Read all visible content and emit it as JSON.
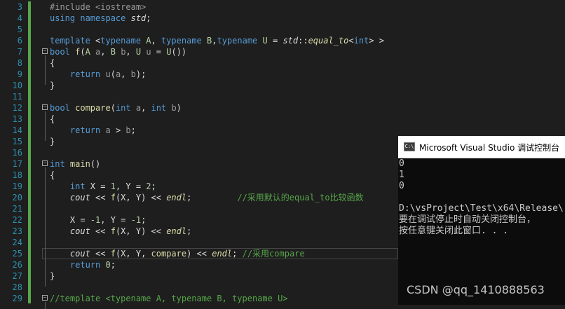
{
  "editor": {
    "lines": [
      {
        "num": "3",
        "tokens": [
          {
            "t": "#include <iostream>",
            "c": "pp"
          }
        ]
      },
      {
        "num": "4",
        "tokens": [
          {
            "t": "using namespace ",
            "c": "kw"
          },
          {
            "t": "std",
            "c": "ns"
          },
          {
            "t": ";",
            "c": "id"
          }
        ]
      },
      {
        "num": "5",
        "tokens": []
      },
      {
        "num": "6",
        "tokens": [
          {
            "t": "template ",
            "c": "kw"
          },
          {
            "t": "<",
            "c": "id"
          },
          {
            "t": "typename ",
            "c": "kw"
          },
          {
            "t": "A",
            "c": "tp"
          },
          {
            "t": ", ",
            "c": "id"
          },
          {
            "t": "typename ",
            "c": "kw"
          },
          {
            "t": "B",
            "c": "tp"
          },
          {
            "t": ",",
            "c": "id"
          },
          {
            "t": "typename ",
            "c": "kw"
          },
          {
            "t": "U",
            "c": "tp"
          },
          {
            "t": " = ",
            "c": "id"
          },
          {
            "t": "std",
            "c": "ns"
          },
          {
            "t": "::",
            "c": "id"
          },
          {
            "t": "equal_to",
            "c": "ital-fn"
          },
          {
            "t": "<",
            "c": "id"
          },
          {
            "t": "int",
            "c": "kw"
          },
          {
            "t": "> >",
            "c": "id"
          }
        ]
      },
      {
        "num": "7",
        "fold": true,
        "tokens": [
          {
            "t": "bool ",
            "c": "kw"
          },
          {
            "t": "f",
            "c": "fn"
          },
          {
            "t": "(",
            "c": "id"
          },
          {
            "t": "A ",
            "c": "tp"
          },
          {
            "t": "a",
            "c": "par"
          },
          {
            "t": ", ",
            "c": "id"
          },
          {
            "t": "B ",
            "c": "tp"
          },
          {
            "t": "b",
            "c": "par"
          },
          {
            "t": ", ",
            "c": "id"
          },
          {
            "t": "U ",
            "c": "tp"
          },
          {
            "t": "u",
            "c": "par"
          },
          {
            "t": " = ",
            "c": "id"
          },
          {
            "t": "U",
            "c": "tp"
          },
          {
            "t": "())",
            "c": "id"
          }
        ]
      },
      {
        "num": "8",
        "tokens": [
          {
            "t": "{",
            "c": "id"
          }
        ]
      },
      {
        "num": "9",
        "tokens": [
          {
            "t": "    return ",
            "c": "kw"
          },
          {
            "t": "u",
            "c": "par"
          },
          {
            "t": "(",
            "c": "id"
          },
          {
            "t": "a",
            "c": "par"
          },
          {
            "t": ", ",
            "c": "id"
          },
          {
            "t": "b",
            "c": "par"
          },
          {
            "t": ");",
            "c": "id"
          }
        ]
      },
      {
        "num": "10",
        "tokens": [
          {
            "t": "}",
            "c": "id"
          }
        ]
      },
      {
        "num": "11",
        "tokens": []
      },
      {
        "num": "12",
        "fold": true,
        "tokens": [
          {
            "t": "bool ",
            "c": "kw"
          },
          {
            "t": "compare",
            "c": "fn"
          },
          {
            "t": "(",
            "c": "id"
          },
          {
            "t": "int ",
            "c": "kw"
          },
          {
            "t": "a",
            "c": "par"
          },
          {
            "t": ", ",
            "c": "id"
          },
          {
            "t": "int ",
            "c": "kw"
          },
          {
            "t": "b",
            "c": "par"
          },
          {
            "t": ")",
            "c": "id"
          }
        ]
      },
      {
        "num": "13",
        "tokens": [
          {
            "t": "{",
            "c": "id"
          }
        ]
      },
      {
        "num": "14",
        "tokens": [
          {
            "t": "    return ",
            "c": "kw"
          },
          {
            "t": "a",
            "c": "par"
          },
          {
            "t": " > ",
            "c": "id"
          },
          {
            "t": "b",
            "c": "par"
          },
          {
            "t": ";",
            "c": "id"
          }
        ]
      },
      {
        "num": "15",
        "tokens": [
          {
            "t": "}",
            "c": "id"
          }
        ]
      },
      {
        "num": "16",
        "tokens": []
      },
      {
        "num": "17",
        "fold": true,
        "tokens": [
          {
            "t": "int ",
            "c": "kw"
          },
          {
            "t": "main",
            "c": "fn"
          },
          {
            "t": "()",
            "c": "id"
          }
        ]
      },
      {
        "num": "18",
        "tokens": [
          {
            "t": "{",
            "c": "id"
          }
        ]
      },
      {
        "num": "19",
        "tokens": [
          {
            "t": "    int ",
            "c": "kw"
          },
          {
            "t": "X = ",
            "c": "id"
          },
          {
            "t": "1",
            "c": "num"
          },
          {
            "t": ", Y = ",
            "c": "id"
          },
          {
            "t": "2",
            "c": "num"
          },
          {
            "t": ";",
            "c": "id"
          }
        ]
      },
      {
        "num": "20",
        "tokens": [
          {
            "t": "    ",
            "c": "id"
          },
          {
            "t": "cout",
            "c": "ns"
          },
          {
            "t": " << ",
            "c": "id"
          },
          {
            "t": "f",
            "c": "fn"
          },
          {
            "t": "(X, Y) << ",
            "c": "id"
          },
          {
            "t": "endl",
            "c": "ital-fn"
          },
          {
            "t": ";         ",
            "c": "id"
          },
          {
            "t": "//采用默认的equal_to比较函数",
            "c": "cmt"
          }
        ]
      },
      {
        "num": "21",
        "tokens": []
      },
      {
        "num": "22",
        "tokens": [
          {
            "t": "    X = ",
            "c": "id"
          },
          {
            "t": "-1",
            "c": "num"
          },
          {
            "t": ", Y = ",
            "c": "id"
          },
          {
            "t": "-1",
            "c": "num"
          },
          {
            "t": ";",
            "c": "id"
          }
        ]
      },
      {
        "num": "23",
        "tokens": [
          {
            "t": "    ",
            "c": "id"
          },
          {
            "t": "cout",
            "c": "ns"
          },
          {
            "t": " << ",
            "c": "id"
          },
          {
            "t": "f",
            "c": "fn"
          },
          {
            "t": "(X, Y) << ",
            "c": "id"
          },
          {
            "t": "endl",
            "c": "ital-fn"
          },
          {
            "t": ";",
            "c": "id"
          }
        ]
      },
      {
        "num": "24",
        "tokens": []
      },
      {
        "num": "25",
        "current": true,
        "tokens": [
          {
            "t": "    ",
            "c": "id"
          },
          {
            "t": "cout",
            "c": "ns"
          },
          {
            "t": " << ",
            "c": "id"
          },
          {
            "t": "f",
            "c": "fn"
          },
          {
            "t": "(X, Y, ",
            "c": "id"
          },
          {
            "t": "compare",
            "c": "fn"
          },
          {
            "t": ") << ",
            "c": "id"
          },
          {
            "t": "endl",
            "c": "ital-fn"
          },
          {
            "t": "; ",
            "c": "id"
          },
          {
            "t": "//采用compare",
            "c": "cmt"
          }
        ]
      },
      {
        "num": "26",
        "tokens": [
          {
            "t": "    return ",
            "c": "kw"
          },
          {
            "t": "0",
            "c": "num"
          },
          {
            "t": ";",
            "c": "id"
          }
        ]
      },
      {
        "num": "27",
        "tokens": [
          {
            "t": "}",
            "c": "id"
          }
        ]
      },
      {
        "num": "28",
        "tokens": []
      },
      {
        "num": "29",
        "fold": true,
        "tokens": [
          {
            "t": "//template <typename A, typename B, typename U>",
            "c": "cmt"
          }
        ]
      }
    ]
  },
  "console": {
    "icon_label": "C:\\",
    "title": "Microsoft Visual Studio 调试控制台",
    "output": [
      "0",
      "1",
      "0",
      "",
      "D:\\vsProject\\Test\\x64\\Release\\",
      "要在调试停止时自动关闭控制台，",
      "按任意键关闭此窗口. . ."
    ]
  },
  "watermark": "CSDN @qq_1410888563",
  "colors": {
    "editor_bg": "#1e1e1e",
    "line_number": "#2b91af",
    "keyword": "#569cd6",
    "comment": "#57a64a",
    "function": "#dcdcaa",
    "type": "#b8d7a3",
    "console_bg": "#0c0c0c"
  }
}
